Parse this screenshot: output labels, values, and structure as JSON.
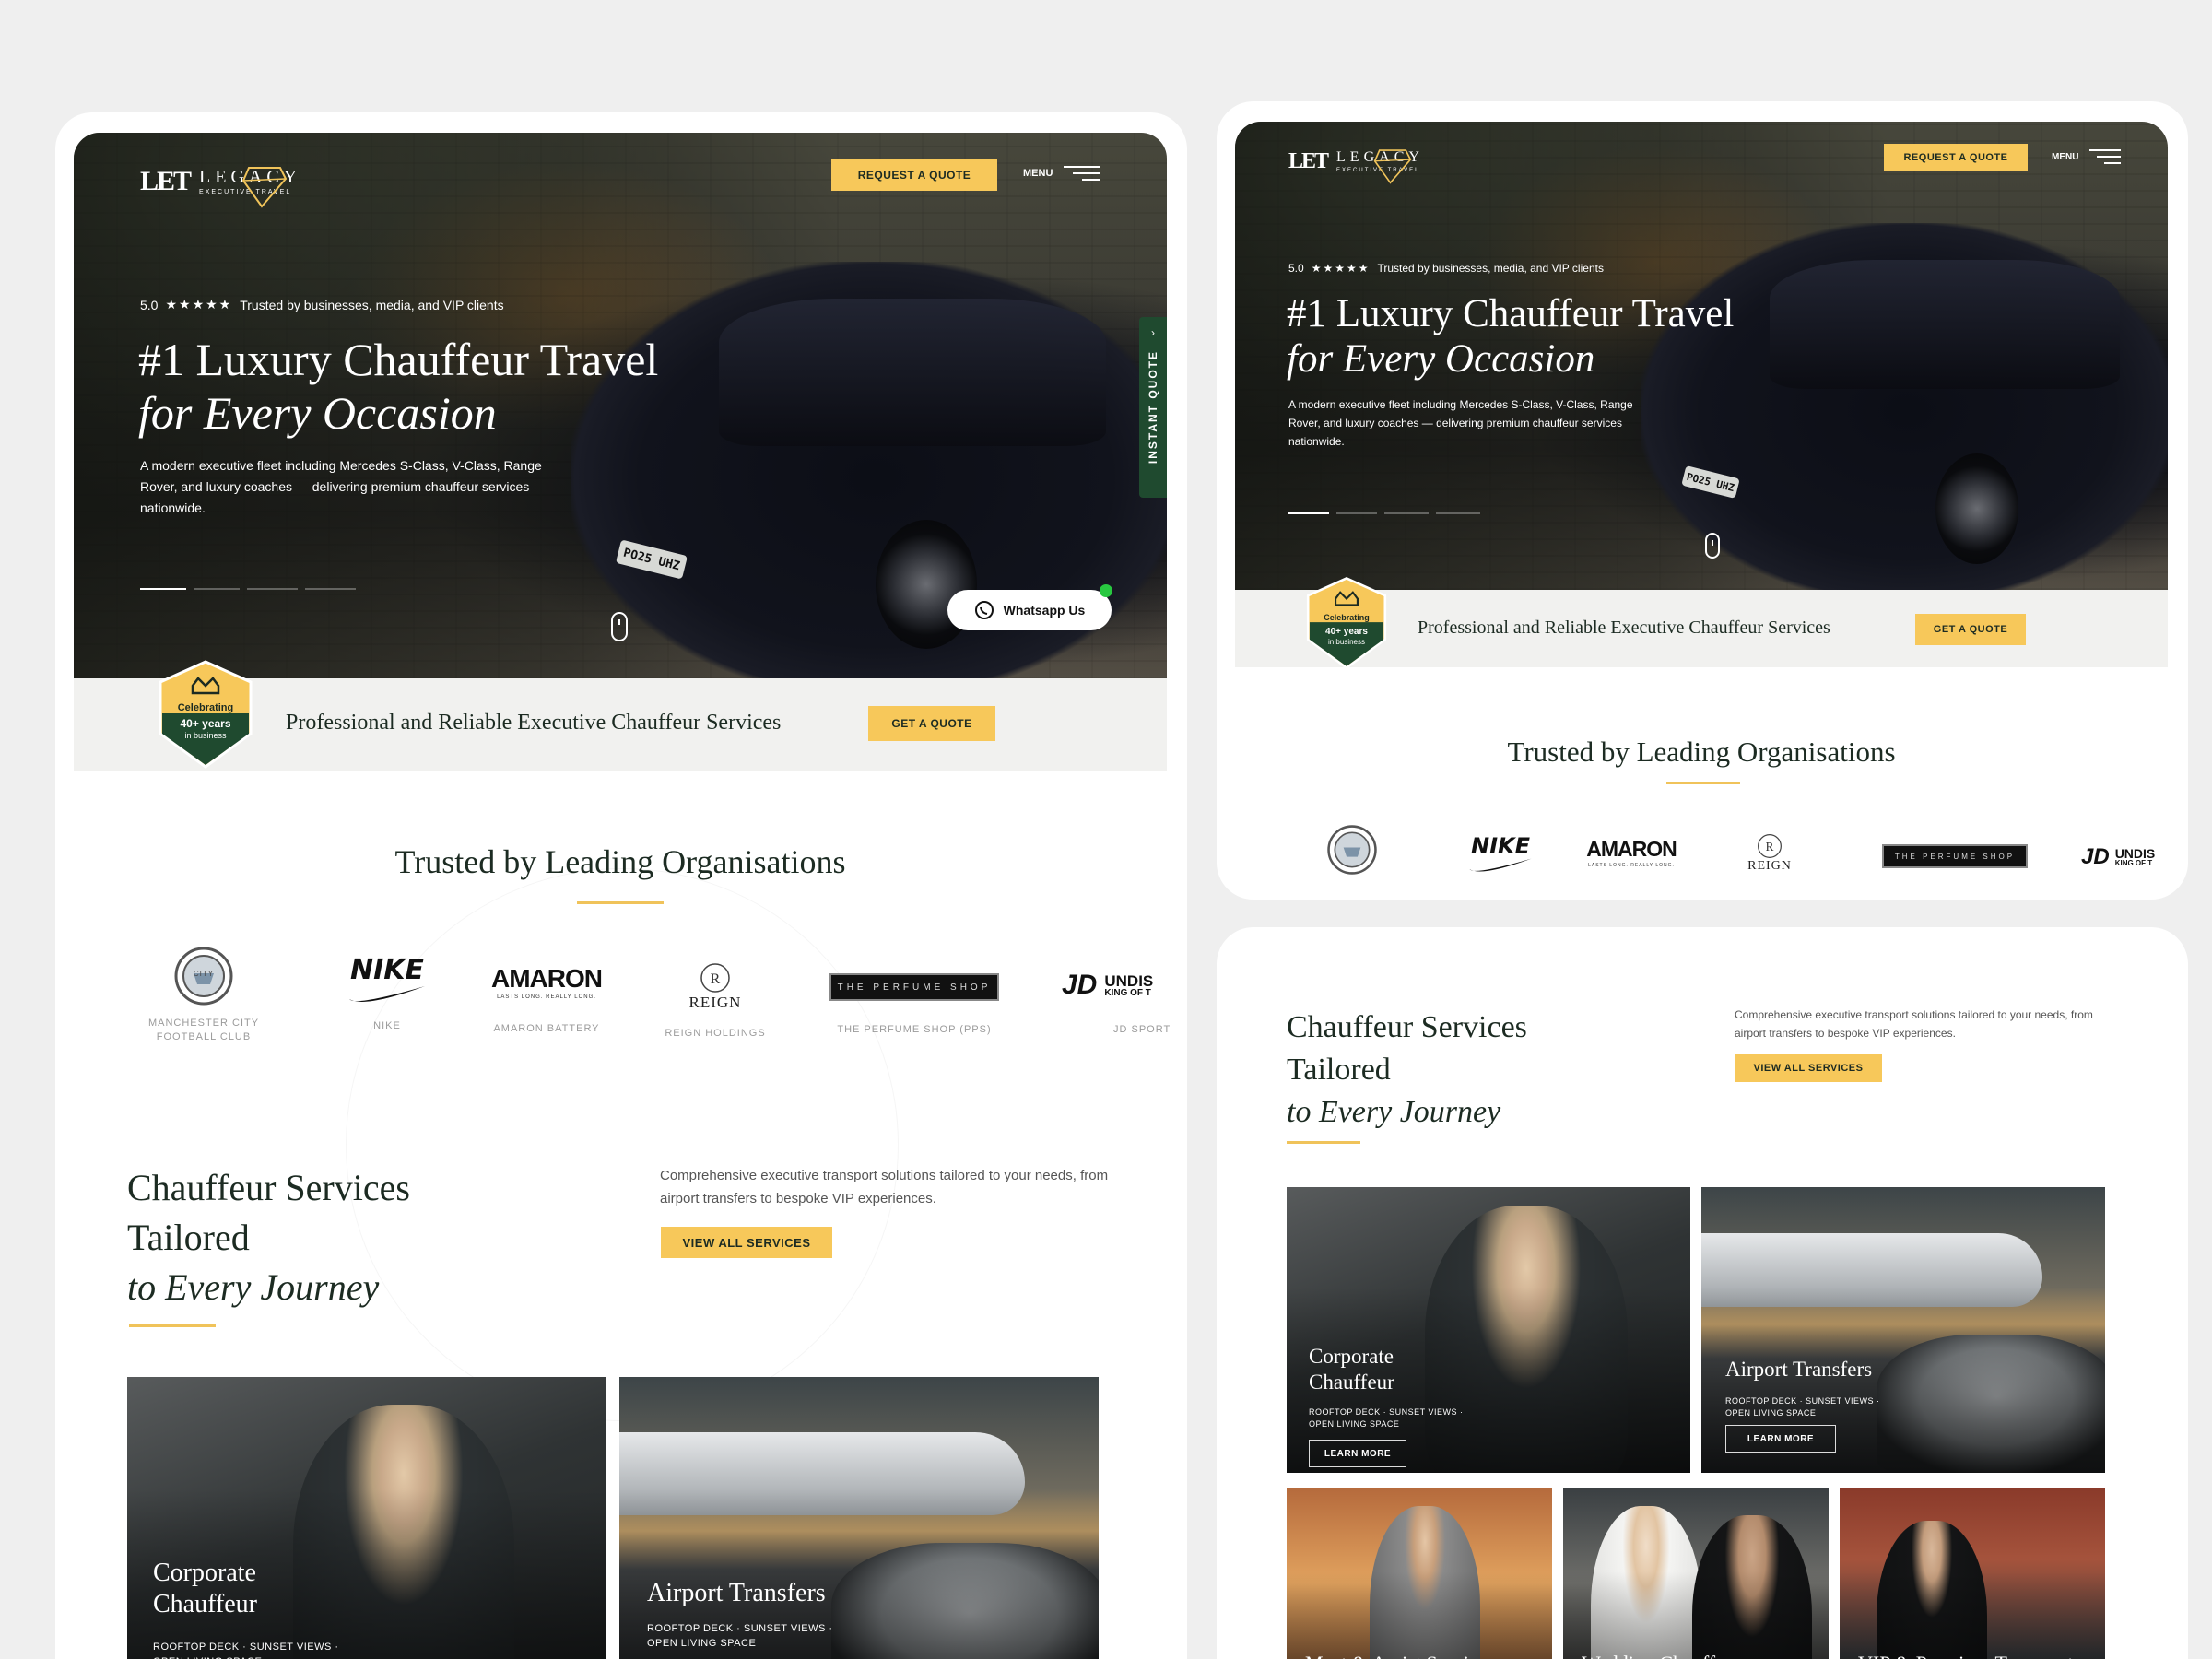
{
  "brand": {
    "mark": "LET",
    "name": "LEGACY",
    "tagline": "EXECUTIVE TRAVEL"
  },
  "header": {
    "quote_button": "REQUEST A QUOTE",
    "menu_label": "MENU"
  },
  "hero": {
    "rating": "5.0",
    "stars": "★★★★★",
    "trust_text": "Trusted by businesses, media, and VIP clients",
    "title_line1": "#1 Luxury Chauffeur Travel",
    "title_line2": "for Every Occasion",
    "description": "A modern executive fleet including Mercedes S-Class, V-Class, Range Rover, and luxury coaches — delivering premium chauffeur services nationwide.",
    "plate": "PO25 UHZ",
    "instant_quote": "INSTANT QUOTE",
    "whatsapp": "Whatsapp Us"
  },
  "strip": {
    "badge_line1": "Celebrating",
    "badge_line2": "40+ years",
    "badge_line3": "in business",
    "text": "Professional and Reliable Executive Chauffeur Services",
    "quote_button": "GET A QUOTE"
  },
  "trusted": {
    "title": "Trusted by Leading Organisations",
    "clients": [
      {
        "name": "MANCHESTER CITY FOOTBALL CLUB",
        "logo": "CITY"
      },
      {
        "name": "NIKE",
        "logo": "NIKE"
      },
      {
        "name": "AMARON BATTERY",
        "logo": "AMARON",
        "logo_sub": "LASTS LONG. REALLY LONG."
      },
      {
        "name": "REIGN HOLDINGS",
        "logo": "REIGN"
      },
      {
        "name": "THE PERFUME SHOP (PPS)",
        "logo": "THE PERFUME SHOP"
      },
      {
        "name": "JD SPORT",
        "logo": "JD",
        "logo_sub1": "UNDIS",
        "logo_sub2": "KING OF T"
      }
    ]
  },
  "services": {
    "title_line1": "Chauffeur Services",
    "title_line2": "Tailored",
    "title_line3": "to Every Journey",
    "description": "Comprehensive executive transport solutions tailored to your needs, from airport transfers to bespoke VIP experiences.",
    "view_all": "VIEW ALL SERVICES",
    "cards": [
      {
        "title_line1": "Corporate",
        "title_line2": "Chauffeur",
        "sub_line1": "ROOFTOP DECK · SUNSET VIEWS ·",
        "sub_line2": "OPEN LIVING SPACE",
        "button": "LEARN MORE"
      },
      {
        "title_line1": "Airport Transfers",
        "sub_line1": "ROOFTOP DECK · SUNSET VIEWS ·",
        "sub_line2": "OPEN LIVING SPACE",
        "button": "LEARN MORE"
      },
      {
        "title_line1": "Meet & Assist Services"
      },
      {
        "title_line1": "Wedding Chauffeur"
      },
      {
        "title_line1": "VIP & Premium Transport"
      }
    ]
  },
  "colors": {
    "accent": "#f7c85a",
    "dark_green": "#1f4a2f",
    "text_dark": "#1c2b22",
    "whatsapp_dot": "#28c840"
  }
}
